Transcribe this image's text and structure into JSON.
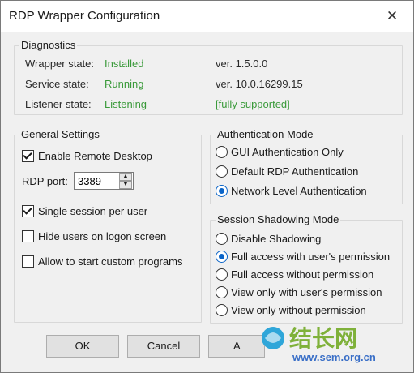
{
  "window": {
    "title": "RDP Wrapper Configuration"
  },
  "diagnostics": {
    "title": "Diagnostics",
    "wrapper": {
      "label": "Wrapper state:",
      "value": "Installed",
      "version": "ver.  1.5.0.0"
    },
    "service": {
      "label": "Service state:",
      "value": "Running",
      "version": "ver.  10.0.16299.15"
    },
    "listener": {
      "label": "Listener state:",
      "value": "Listening",
      "version": "[fully supported]"
    }
  },
  "general": {
    "title": "General Settings",
    "enable_remote_desktop": {
      "label": "Enable Remote Desktop",
      "checked": true
    },
    "rdp_port": {
      "label": "RDP port:",
      "value": "3389"
    },
    "single_session": {
      "label": "Single session per user",
      "checked": true
    },
    "hide_users": {
      "label": "Hide users on logon screen",
      "checked": false
    },
    "custom_programs": {
      "label": "Allow to start custom programs",
      "checked": false
    }
  },
  "auth": {
    "title": "Authentication Mode",
    "options": [
      {
        "label": "GUI Authentication Only",
        "selected": false
      },
      {
        "label": "Default RDP Authentication",
        "selected": false
      },
      {
        "label": "Network Level Authentication",
        "selected": true
      }
    ]
  },
  "shadow": {
    "title": "Session Shadowing Mode",
    "options": [
      {
        "label": "Disable Shadowing",
        "selected": false
      },
      {
        "label": "Full access with user's permission",
        "selected": true
      },
      {
        "label": "Full access without permission",
        "selected": false
      },
      {
        "label": "View only with user's permission",
        "selected": false
      },
      {
        "label": "View only without permission",
        "selected": false
      }
    ]
  },
  "buttons": {
    "ok": "OK",
    "cancel": "Cancel",
    "apply": "A"
  },
  "watermark": {
    "logo_text": "结长网",
    "url": "www.sem.org.cn"
  },
  "colors": {
    "status_green": "#3a9a3a",
    "radio_accent": "#0a64c8"
  }
}
